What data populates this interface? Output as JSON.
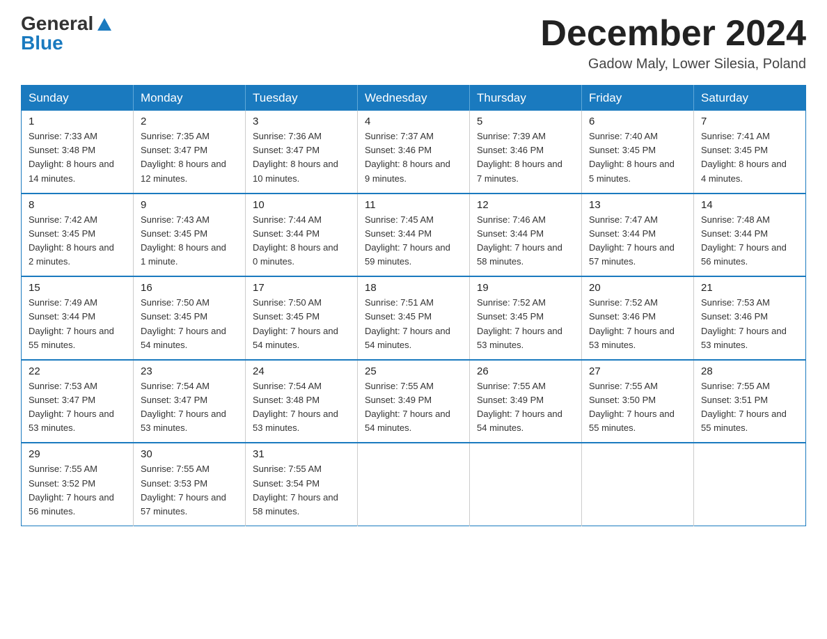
{
  "header": {
    "logo_general": "General",
    "logo_blue": "Blue",
    "month_title": "December 2024",
    "location": "Gadow Maly, Lower Silesia, Poland"
  },
  "days_of_week": [
    "Sunday",
    "Monday",
    "Tuesday",
    "Wednesday",
    "Thursday",
    "Friday",
    "Saturday"
  ],
  "weeks": [
    [
      {
        "day": "1",
        "sunrise": "7:33 AM",
        "sunset": "3:48 PM",
        "daylight": "8 hours and 14 minutes."
      },
      {
        "day": "2",
        "sunrise": "7:35 AM",
        "sunset": "3:47 PM",
        "daylight": "8 hours and 12 minutes."
      },
      {
        "day": "3",
        "sunrise": "7:36 AM",
        "sunset": "3:47 PM",
        "daylight": "8 hours and 10 minutes."
      },
      {
        "day": "4",
        "sunrise": "7:37 AM",
        "sunset": "3:46 PM",
        "daylight": "8 hours and 9 minutes."
      },
      {
        "day": "5",
        "sunrise": "7:39 AM",
        "sunset": "3:46 PM",
        "daylight": "8 hours and 7 minutes."
      },
      {
        "day": "6",
        "sunrise": "7:40 AM",
        "sunset": "3:45 PM",
        "daylight": "8 hours and 5 minutes."
      },
      {
        "day": "7",
        "sunrise": "7:41 AM",
        "sunset": "3:45 PM",
        "daylight": "8 hours and 4 minutes."
      }
    ],
    [
      {
        "day": "8",
        "sunrise": "7:42 AM",
        "sunset": "3:45 PM",
        "daylight": "8 hours and 2 minutes."
      },
      {
        "day": "9",
        "sunrise": "7:43 AM",
        "sunset": "3:45 PM",
        "daylight": "8 hours and 1 minute."
      },
      {
        "day": "10",
        "sunrise": "7:44 AM",
        "sunset": "3:44 PM",
        "daylight": "8 hours and 0 minutes."
      },
      {
        "day": "11",
        "sunrise": "7:45 AM",
        "sunset": "3:44 PM",
        "daylight": "7 hours and 59 minutes."
      },
      {
        "day": "12",
        "sunrise": "7:46 AM",
        "sunset": "3:44 PM",
        "daylight": "7 hours and 58 minutes."
      },
      {
        "day": "13",
        "sunrise": "7:47 AM",
        "sunset": "3:44 PM",
        "daylight": "7 hours and 57 minutes."
      },
      {
        "day": "14",
        "sunrise": "7:48 AM",
        "sunset": "3:44 PM",
        "daylight": "7 hours and 56 minutes."
      }
    ],
    [
      {
        "day": "15",
        "sunrise": "7:49 AM",
        "sunset": "3:44 PM",
        "daylight": "7 hours and 55 minutes."
      },
      {
        "day": "16",
        "sunrise": "7:50 AM",
        "sunset": "3:45 PM",
        "daylight": "7 hours and 54 minutes."
      },
      {
        "day": "17",
        "sunrise": "7:50 AM",
        "sunset": "3:45 PM",
        "daylight": "7 hours and 54 minutes."
      },
      {
        "day": "18",
        "sunrise": "7:51 AM",
        "sunset": "3:45 PM",
        "daylight": "7 hours and 54 minutes."
      },
      {
        "day": "19",
        "sunrise": "7:52 AM",
        "sunset": "3:45 PM",
        "daylight": "7 hours and 53 minutes."
      },
      {
        "day": "20",
        "sunrise": "7:52 AM",
        "sunset": "3:46 PM",
        "daylight": "7 hours and 53 minutes."
      },
      {
        "day": "21",
        "sunrise": "7:53 AM",
        "sunset": "3:46 PM",
        "daylight": "7 hours and 53 minutes."
      }
    ],
    [
      {
        "day": "22",
        "sunrise": "7:53 AM",
        "sunset": "3:47 PM",
        "daylight": "7 hours and 53 minutes."
      },
      {
        "day": "23",
        "sunrise": "7:54 AM",
        "sunset": "3:47 PM",
        "daylight": "7 hours and 53 minutes."
      },
      {
        "day": "24",
        "sunrise": "7:54 AM",
        "sunset": "3:48 PM",
        "daylight": "7 hours and 53 minutes."
      },
      {
        "day": "25",
        "sunrise": "7:55 AM",
        "sunset": "3:49 PM",
        "daylight": "7 hours and 54 minutes."
      },
      {
        "day": "26",
        "sunrise": "7:55 AM",
        "sunset": "3:49 PM",
        "daylight": "7 hours and 54 minutes."
      },
      {
        "day": "27",
        "sunrise": "7:55 AM",
        "sunset": "3:50 PM",
        "daylight": "7 hours and 55 minutes."
      },
      {
        "day": "28",
        "sunrise": "7:55 AM",
        "sunset": "3:51 PM",
        "daylight": "7 hours and 55 minutes."
      }
    ],
    [
      {
        "day": "29",
        "sunrise": "7:55 AM",
        "sunset": "3:52 PM",
        "daylight": "7 hours and 56 minutes."
      },
      {
        "day": "30",
        "sunrise": "7:55 AM",
        "sunset": "3:53 PM",
        "daylight": "7 hours and 57 minutes."
      },
      {
        "day": "31",
        "sunrise": "7:55 AM",
        "sunset": "3:54 PM",
        "daylight": "7 hours and 58 minutes."
      },
      null,
      null,
      null,
      null
    ]
  ],
  "labels": {
    "sunrise": "Sunrise:",
    "sunset": "Sunset:",
    "daylight": "Daylight:"
  }
}
